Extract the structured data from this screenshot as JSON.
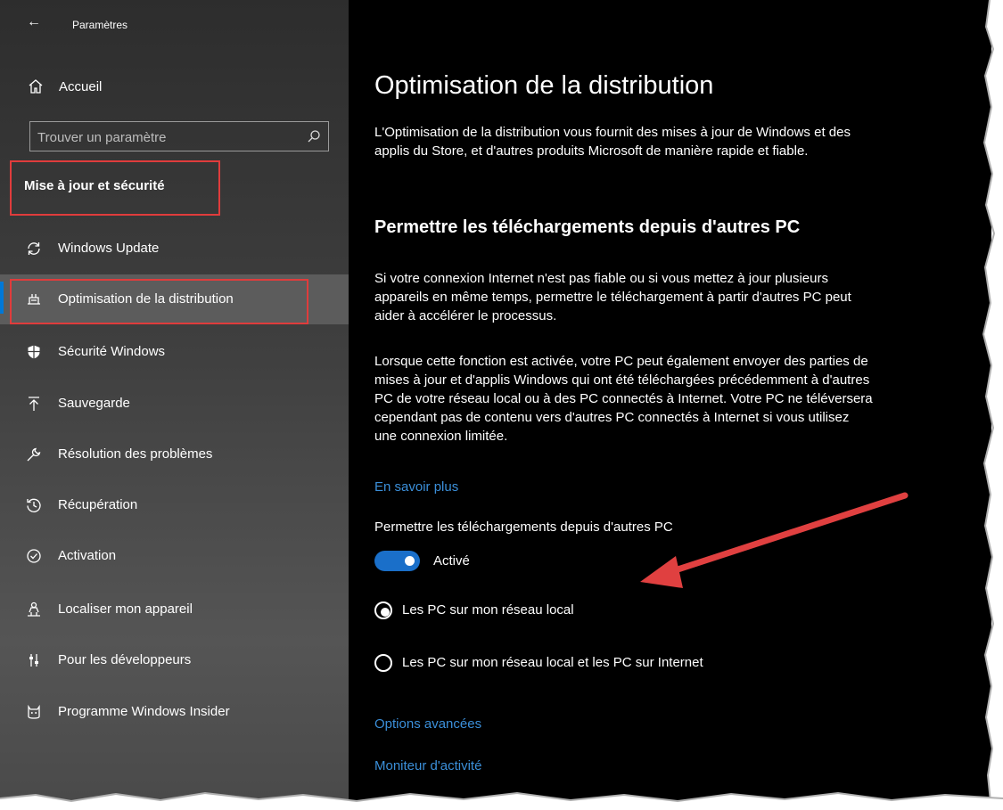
{
  "app_title": "Paramètres",
  "home_label": "Accueil",
  "search": {
    "placeholder": "Trouver un paramètre"
  },
  "section_heading": "Mise à jour et sécurité",
  "nav": [
    {
      "label": "Windows Update",
      "icon": "sync-icon"
    },
    {
      "label": "Optimisation de la distribution",
      "icon": "delivery-optimization-icon",
      "selected": true
    },
    {
      "label": "Sécurité Windows",
      "icon": "shield-icon"
    },
    {
      "label": "Sauvegarde",
      "icon": "upload-icon"
    },
    {
      "label": "Résolution des problèmes",
      "icon": "wrench-icon"
    },
    {
      "label": "Récupération",
      "icon": "history-icon"
    },
    {
      "label": "Activation",
      "icon": "check-circle-icon"
    },
    {
      "label": "Localiser mon appareil",
      "icon": "person-pin-icon"
    },
    {
      "label": "Pour les développeurs",
      "icon": "dev-sliders-icon"
    },
    {
      "label": "Programme Windows Insider",
      "icon": "insider-cat-icon"
    }
  ],
  "main": {
    "title": "Optimisation de la distribution",
    "intro": "L'Optimisation de la distribution vous fournit des mises à jour de Windows et des applis du Store, et d'autres produits Microsoft de manière rapide et fiable.",
    "subheading": "Permettre les téléchargements depuis d'autres PC",
    "para1": "Si votre connexion Internet n'est pas fiable ou si vous mettez à jour plusieurs appareils en même temps, permettre le téléchargement à partir d'autres PC peut aider à accélérer le processus.",
    "para2": "Lorsque cette fonction est activée, votre PC peut également envoyer des parties de mises à jour et d'applis Windows qui ont été téléchargées précédemment à d'autres PC de votre réseau local ou à des PC connectés à Internet. Votre PC ne téléversera cependant pas de contenu vers d'autres PC connectés à Internet si vous utilisez une connexion limitée.",
    "learn_more": "En savoir plus",
    "toggle_label": "Permettre les téléchargements depuis d'autres PC",
    "toggle_state": "Activé",
    "toggle_on": true,
    "radio_options": [
      {
        "label": "Les PC sur mon réseau local",
        "selected": true
      },
      {
        "label": "Les PC sur mon réseau local et les PC sur Internet",
        "selected": false
      }
    ],
    "link_advanced": "Options avancées",
    "link_monitor": "Moniteur d'activité"
  },
  "colors": {
    "accent": "#0078d7",
    "link": "#3b8fd9",
    "highlight_box": "#e03c3c",
    "annotation_arrow": "#e04040"
  }
}
